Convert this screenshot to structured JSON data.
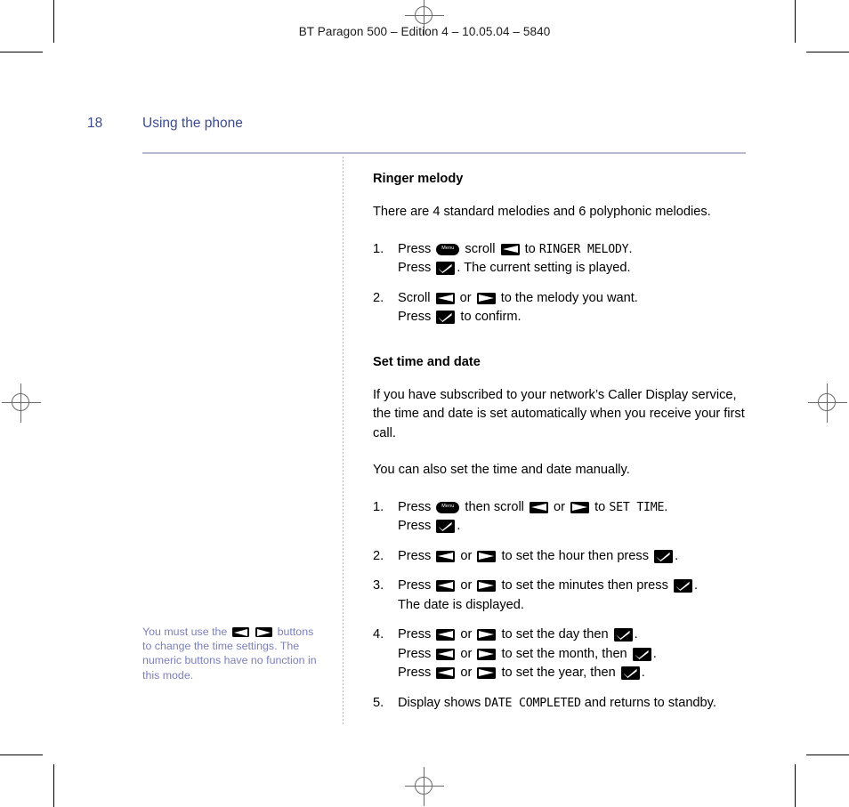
{
  "running_head": "BT Paragon 500 – Edition 4 – 10.05.04 – 5840",
  "header": {
    "page_number": "18",
    "section_title": "Using the phone",
    "rule_color": "#b9b9d4",
    "text_color": "#3b4a93"
  },
  "icons": {
    "menu_label": "Menu",
    "menu_icon_name": "menu-key-icon",
    "scroll_left_icon_name": "scroll-left-key-icon",
    "scroll_right_icon_name": "scroll-right-key-icon",
    "confirm_icon_name": "confirm-tick-key-icon"
  },
  "sidenote": {
    "text_color": "#7b7fbd",
    "part1": "You must use the ",
    "part2": " buttons to change the time settings. The numeric buttons have no function in this mode."
  },
  "sections": [
    {
      "heading": "Ringer melody",
      "intro": "There are 4 standard melodies and 6 polyphonic melodies.",
      "steps": [
        {
          "number": "1.",
          "lines": [
            [
              {
                "t": "text",
                "v": "Press "
              },
              {
                "t": "icon",
                "v": "menu"
              },
              {
                "t": "text",
                "v": " scroll "
              },
              {
                "t": "icon",
                "v": "left"
              },
              {
                "t": "text",
                "v": " to "
              },
              {
                "t": "mono",
                "v": "RINGER MELODY"
              },
              {
                "t": "text",
                "v": "."
              }
            ],
            [
              {
                "t": "text",
                "v": "Press "
              },
              {
                "t": "icon",
                "v": "ok"
              },
              {
                "t": "text",
                "v": ". The current setting is played."
              }
            ]
          ]
        },
        {
          "number": "2.",
          "lines": [
            [
              {
                "t": "text",
                "v": "Scroll "
              },
              {
                "t": "icon",
                "v": "left"
              },
              {
                "t": "text",
                "v": " or "
              },
              {
                "t": "icon",
                "v": "right"
              },
              {
                "t": "text",
                "v": " to the melody you want."
              }
            ],
            [
              {
                "t": "text",
                "v": "Press "
              },
              {
                "t": "icon",
                "v": "ok"
              },
              {
                "t": "text",
                "v": " to confirm."
              }
            ]
          ]
        }
      ]
    },
    {
      "heading": "Set time and date",
      "intro": "If you have subscribed to your network’s Caller Display service, the time and date is set automatically when you receive your first call.",
      "intro2": "You can also set the time and date manually.",
      "steps": [
        {
          "number": "1.",
          "lines": [
            [
              {
                "t": "text",
                "v": "Press "
              },
              {
                "t": "icon",
                "v": "menu"
              },
              {
                "t": "text",
                "v": " then scroll "
              },
              {
                "t": "icon",
                "v": "left"
              },
              {
                "t": "text",
                "v": " or "
              },
              {
                "t": "icon",
                "v": "right"
              },
              {
                "t": "text",
                "v": " to "
              },
              {
                "t": "mono",
                "v": "SET TIME"
              },
              {
                "t": "text",
                "v": "."
              }
            ],
            [
              {
                "t": "text",
                "v": "Press "
              },
              {
                "t": "icon",
                "v": "ok"
              },
              {
                "t": "text",
                "v": "."
              }
            ]
          ]
        },
        {
          "number": "2.",
          "lines": [
            [
              {
                "t": "text",
                "v": "Press "
              },
              {
                "t": "icon",
                "v": "left"
              },
              {
                "t": "text",
                "v": " or "
              },
              {
                "t": "icon",
                "v": "right"
              },
              {
                "t": "text",
                "v": " to set the hour then press "
              },
              {
                "t": "icon",
                "v": "ok"
              },
              {
                "t": "text",
                "v": "."
              }
            ]
          ]
        },
        {
          "number": "3.",
          "lines": [
            [
              {
                "t": "text",
                "v": "Press "
              },
              {
                "t": "icon",
                "v": "left"
              },
              {
                "t": "text",
                "v": " or "
              },
              {
                "t": "icon",
                "v": "right"
              },
              {
                "t": "text",
                "v": " to set the minutes then press "
              },
              {
                "t": "icon",
                "v": "ok"
              },
              {
                "t": "text",
                "v": "."
              }
            ],
            [
              {
                "t": "text",
                "v": "The date is displayed."
              }
            ]
          ]
        },
        {
          "number": "4.",
          "lines": [
            [
              {
                "t": "text",
                "v": "Press "
              },
              {
                "t": "icon",
                "v": "left"
              },
              {
                "t": "text",
                "v": " or "
              },
              {
                "t": "icon",
                "v": "right"
              },
              {
                "t": "text",
                "v": " to set the day then "
              },
              {
                "t": "icon",
                "v": "ok"
              },
              {
                "t": "text",
                "v": "."
              }
            ],
            [
              {
                "t": "text",
                "v": "Press "
              },
              {
                "t": "icon",
                "v": "left"
              },
              {
                "t": "text",
                "v": " or "
              },
              {
                "t": "icon",
                "v": "right"
              },
              {
                "t": "text",
                "v": " to set the month, then "
              },
              {
                "t": "icon",
                "v": "ok"
              },
              {
                "t": "text",
                "v": "."
              }
            ],
            [
              {
                "t": "text",
                "v": "Press "
              },
              {
                "t": "icon",
                "v": "left"
              },
              {
                "t": "text",
                "v": " or "
              },
              {
                "t": "icon",
                "v": "right"
              },
              {
                "t": "text",
                "v": " to set the year, then "
              },
              {
                "t": "icon",
                "v": "ok"
              },
              {
                "t": "text",
                "v": "."
              }
            ]
          ]
        },
        {
          "number": "5.",
          "lines": [
            [
              {
                "t": "text",
                "v": "Display shows "
              },
              {
                "t": "mono",
                "v": "DATE COMPLETED"
              },
              {
                "t": "text",
                "v": " and returns to standby."
              }
            ]
          ]
        }
      ]
    }
  ]
}
